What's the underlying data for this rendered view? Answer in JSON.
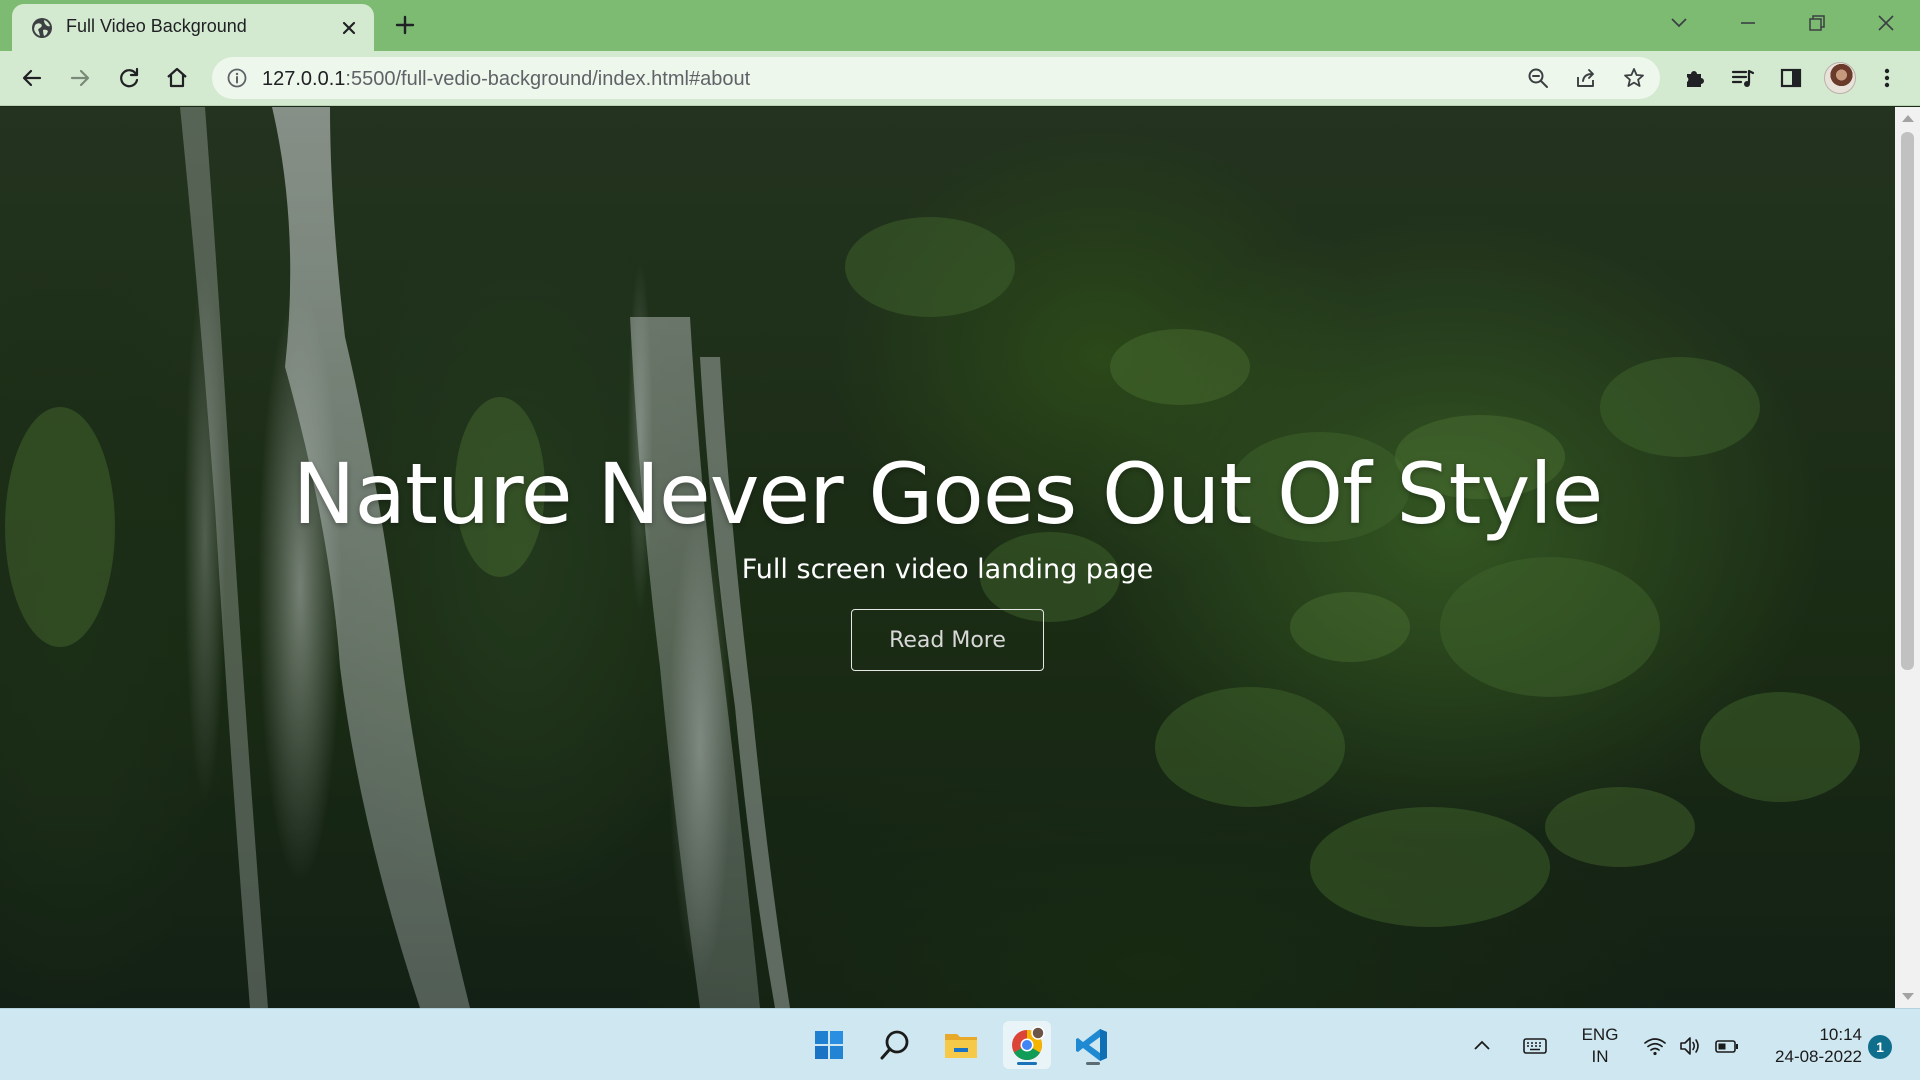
{
  "browser": {
    "tab": {
      "title": "Full Video Background",
      "favicon": "globe-icon"
    },
    "address_bar": {
      "host": "127.0.0.1",
      "path": ":5500/full-vedio-background/index.html#about"
    },
    "colors": {
      "tabstrip": "#7dbb72",
      "toolbar": "#d4ead0"
    }
  },
  "hero": {
    "title": "Nature Never Goes Out Of Style",
    "subtitle": "Full screen video landing page",
    "button_label": "Read More"
  },
  "taskbar": {
    "apps": [
      "windows-start",
      "search",
      "file-explorer",
      "chrome",
      "vscode"
    ],
    "language": {
      "line1": "ENG",
      "line2": "IN"
    },
    "clock": {
      "time": "10:14",
      "date": "24-08-2022"
    },
    "notifications": "1"
  }
}
